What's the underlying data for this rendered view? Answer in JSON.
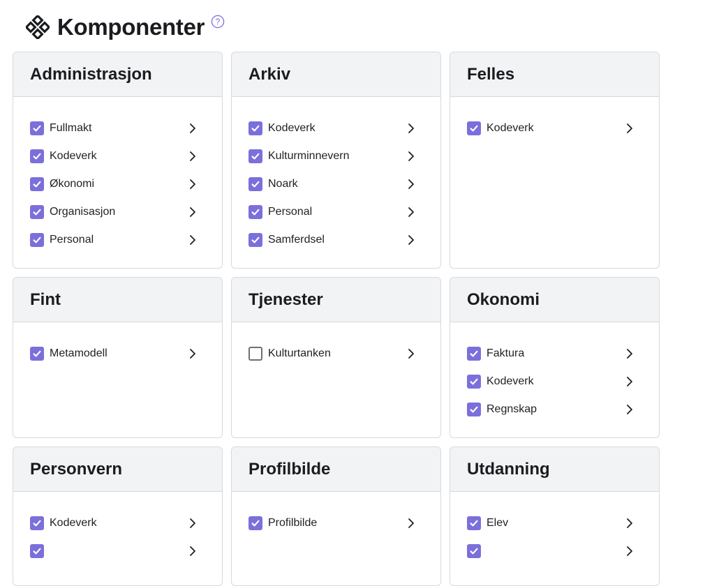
{
  "page": {
    "title": "Komponenter",
    "logo_icon": "diamond-grid-icon",
    "help_icon": "question-circle-icon",
    "accent_color": "#7b6fdc"
  },
  "cards": [
    {
      "title": "Administrasjon",
      "items": [
        {
          "label": "Fullmakt",
          "checked": true
        },
        {
          "label": "Kodeverk",
          "checked": true
        },
        {
          "label": "Økonomi",
          "checked": true
        },
        {
          "label": "Organisasjon",
          "checked": true
        },
        {
          "label": "Personal",
          "checked": true
        }
      ]
    },
    {
      "title": "Arkiv",
      "items": [
        {
          "label": "Kodeverk",
          "checked": true
        },
        {
          "label": "Kulturminnevern",
          "checked": true
        },
        {
          "label": "Noark",
          "checked": true
        },
        {
          "label": "Personal",
          "checked": true
        },
        {
          "label": "Samferdsel",
          "checked": true
        }
      ]
    },
    {
      "title": "Felles",
      "items": [
        {
          "label": "Kodeverk",
          "checked": true
        }
      ]
    },
    {
      "title": "Fint",
      "items": [
        {
          "label": "Metamodell",
          "checked": true
        }
      ]
    },
    {
      "title": "Tjenester",
      "items": [
        {
          "label": "Kulturtanken",
          "checked": false
        }
      ]
    },
    {
      "title": "Okonomi",
      "items": [
        {
          "label": "Faktura",
          "checked": true
        },
        {
          "label": "Kodeverk",
          "checked": true
        },
        {
          "label": "Regnskap",
          "checked": true
        }
      ]
    },
    {
      "title": "Personvern",
      "items": [
        {
          "label": "Kodeverk",
          "checked": true
        },
        {
          "label": "",
          "checked": true
        }
      ]
    },
    {
      "title": "Profilbilde",
      "items": [
        {
          "label": "Profilbilde",
          "checked": true
        }
      ]
    },
    {
      "title": "Utdanning",
      "items": [
        {
          "label": "Elev",
          "checked": true
        },
        {
          "label": "",
          "checked": true
        }
      ]
    }
  ]
}
